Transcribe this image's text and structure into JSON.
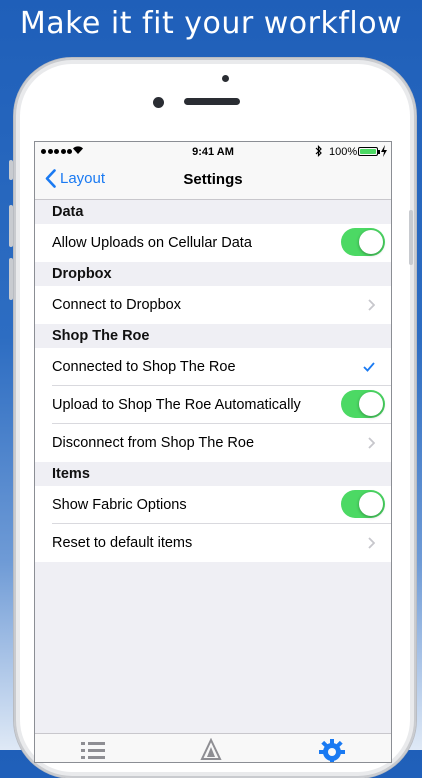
{
  "headline": "Make it fit your workflow",
  "status_bar": {
    "time": "9:41 AM",
    "battery_percent": "100%",
    "signal_icon": "signal-dots-icon",
    "wifi_icon": "wifi-icon",
    "bluetooth_icon": "bluetooth-icon",
    "battery_icon": "battery-icon"
  },
  "nav": {
    "back_label": "Layout",
    "title": "Settings"
  },
  "sections": [
    {
      "header": "Data",
      "rows": [
        {
          "label": "Allow Uploads on Cellular Data",
          "accessory": "toggle",
          "on": true
        }
      ]
    },
    {
      "header": "Dropbox",
      "rows": [
        {
          "label": "Connect to Dropbox",
          "accessory": "chevron"
        }
      ]
    },
    {
      "header": "Shop The Roe",
      "rows": [
        {
          "label": "Connected to Shop The Roe",
          "accessory": "checkmark"
        },
        {
          "label": "Upload to Shop The Roe Automatically",
          "accessory": "toggle",
          "on": true
        },
        {
          "label": "Disconnect from Shop The Roe",
          "accessory": "chevron"
        }
      ]
    },
    {
      "header": "Items",
      "rows": [
        {
          "label": "Show Fabric Options",
          "accessory": "toggle",
          "on": true
        },
        {
          "label": "Reset to default items",
          "accessory": "chevron"
        }
      ]
    }
  ],
  "tabs": [
    {
      "icon": "list-icon",
      "selected": false
    },
    {
      "icon": "layout-triangle-icon",
      "selected": false
    },
    {
      "icon": "gear-icon",
      "selected": true
    }
  ],
  "colors": {
    "tint": "#1a7af2",
    "toggle_on": "#4cd964",
    "background_gradient_top": "#1f5fb9"
  }
}
